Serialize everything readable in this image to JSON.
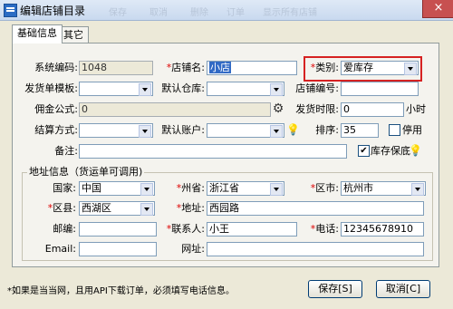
{
  "window": {
    "title": "编辑店铺目录",
    "close_label": "×"
  },
  "toolbar_ghost": [
    "保存",
    "取消",
    "删除",
    "订单",
    "显示所有店铺"
  ],
  "tabs": [
    {
      "label": "基础信息"
    },
    {
      "label": "其它"
    }
  ],
  "basic": {
    "code_label": "系统编码:",
    "code_value": "1048",
    "store_name_label": "店铺名:",
    "store_name_value": "小店",
    "category_label": "类别:",
    "category_value": "爱库存",
    "ship_template_label": "发货单模板:",
    "ship_template_value": "",
    "default_warehouse_label": "默认仓库:",
    "default_warehouse_value": "",
    "store_no_label": "店铺编号:",
    "store_no_value": "",
    "commission_label": "佣金公式:",
    "commission_value": "0",
    "ship_limit_label": "发货时限:",
    "ship_limit_value": "0",
    "ship_limit_unit": "小时",
    "settle_label": "结算方式:",
    "settle_value": "",
    "default_account_label": "默认账户:",
    "default_account_value": "",
    "sort_label": "排序:",
    "sort_value": "35",
    "disable_label": "停用",
    "remark_label": "备注:",
    "remark_value": "",
    "stock_keep_label": "库存保底"
  },
  "address": {
    "group_title": "地址信息（货运单可调用)",
    "country_label": "国家:",
    "country_value": "中国",
    "province_label": "州省:",
    "province_value": "浙江省",
    "city_label": "区市:",
    "city_value": "杭州市",
    "district_label": "区县:",
    "district_value": "西湖区",
    "addr_label": "地址:",
    "addr_value": "西园路",
    "zip_label": "邮编:",
    "zip_value": "",
    "contact_label": "联系人:",
    "contact_value": "小王",
    "phone_label": "电话:",
    "phone_value": "12345678910",
    "email_label": "Email:",
    "email_value": "",
    "web_label": "网址:",
    "web_value": ""
  },
  "footer": {
    "notice": "*如果是当当网，且用API下载订单，必须填写电话信息。",
    "save_label": "保存[S]",
    "cancel_label": "取消[C]"
  }
}
